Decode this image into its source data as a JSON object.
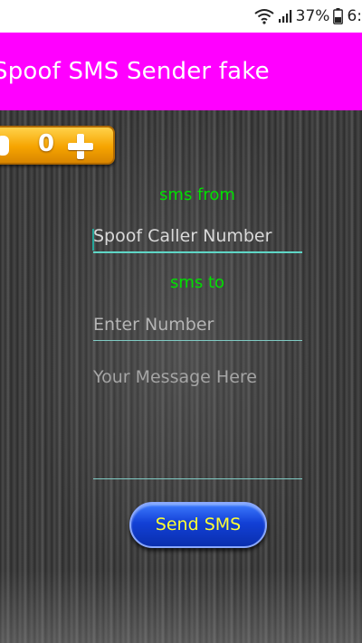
{
  "status_bar": {
    "battery_percent": "37%",
    "time_partial": "6:"
  },
  "app_bar": {
    "title": "Spoof SMS Sender fake",
    "color": "#ff00ff"
  },
  "coins": {
    "count": "0"
  },
  "form": {
    "from_label": "sms from",
    "from_value": "Spoof Caller Number",
    "to_label": "sms to",
    "to_placeholder": "Enter Number",
    "message_placeholder": "Your Message Here",
    "send_label": "Send SMS"
  },
  "colors": {
    "label_green": "#00e000",
    "button_blue": "#1240d6",
    "button_text": "#ffff33",
    "underline": "#80cbc4"
  }
}
